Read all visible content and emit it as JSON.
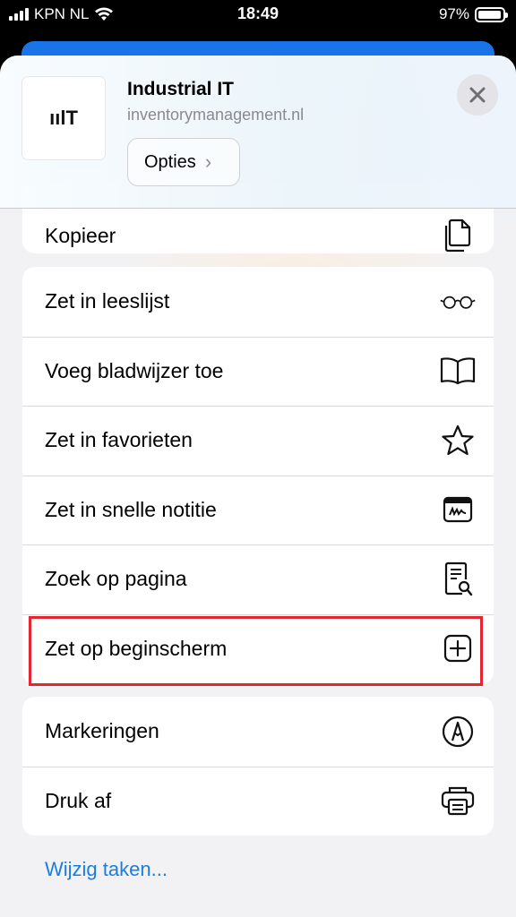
{
  "status_bar": {
    "carrier": "KPN NL",
    "time": "18:49",
    "battery": "97%"
  },
  "header": {
    "logo_text": "ıılT",
    "site_title": "Industrial IT",
    "site_url": "inventorymanagement.nl",
    "options_label": "Opties"
  },
  "groups": {
    "first": {
      "copy_label": "Kopieer"
    },
    "second": {
      "reading_list": "Zet in leeslijst",
      "bookmark": "Voeg bladwijzer toe",
      "favorites": "Zet in favorieten",
      "quick_note": "Zet in snelle notitie",
      "find_on_page": "Zoek op pagina",
      "add_home": "Zet op beginscherm"
    },
    "third": {
      "markup": "Markeringen",
      "print": "Druk af"
    }
  },
  "edit_actions": "Wijzig taken...",
  "colors": {
    "accent": "#1a7ee0",
    "highlight": "#e3262f",
    "background": "#f2f2f5"
  }
}
